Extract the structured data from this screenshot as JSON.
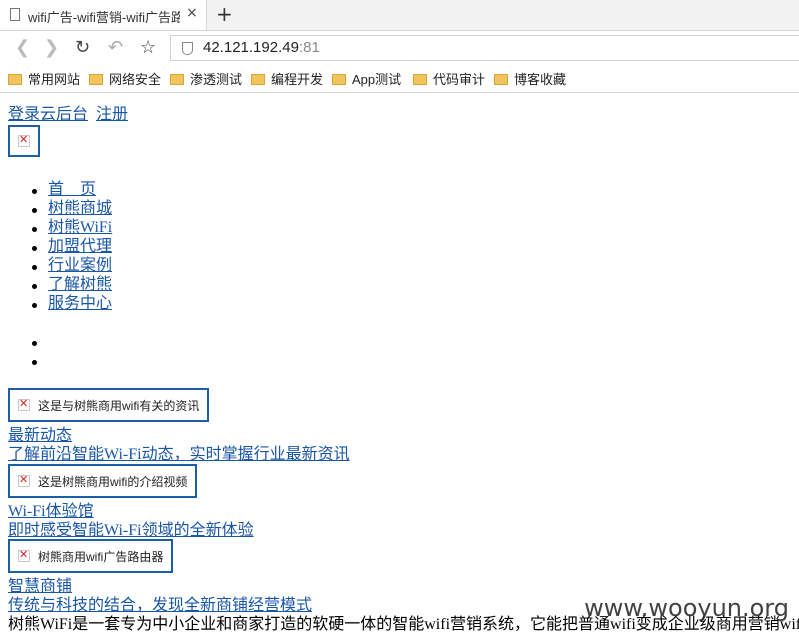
{
  "browser": {
    "tab_title": "wifi广告-wifi营销-wifi广告路",
    "tab_close": "×",
    "new_tab": "+",
    "url_host": "42.121.192.49",
    "url_port": ":81",
    "bookmarks": [
      "常用网站",
      "网络安全",
      "渗透测试",
      "编程开发",
      "App测试",
      "代码审计",
      "博客收藏"
    ]
  },
  "top_links": {
    "login": "登录云后台",
    "register": "注册"
  },
  "nav": [
    "首　页",
    "树熊商城",
    "树熊WiFi",
    "加盟代理",
    "行业案例",
    "了解树熊",
    "服务中心"
  ],
  "sections": [
    {
      "alt": "这是与树熊商用wifi有关的资讯",
      "title": "最新动态",
      "subtitle": "了解前沿智能Wi-Fi动态，实时掌握行业最新资讯"
    },
    {
      "alt": "这是树熊商用wifi的介绍视频",
      "title": "Wi-Fi体验馆",
      "subtitle": "即时感受智能Wi-Fi领域的全新体验"
    },
    {
      "alt": "树熊商用wifi广告路由器",
      "title": "智慧商铺",
      "subtitle": "传统与科技的结合，发现全新商铺经营模式"
    }
  ],
  "description": "树熊WiFi是一套专为中小企业和商家打造的软硬一体的智能wifi营销系统，它能把普通wifi变成企业级商用营销wifi,",
  "watermark": "www.wooyun.org"
}
